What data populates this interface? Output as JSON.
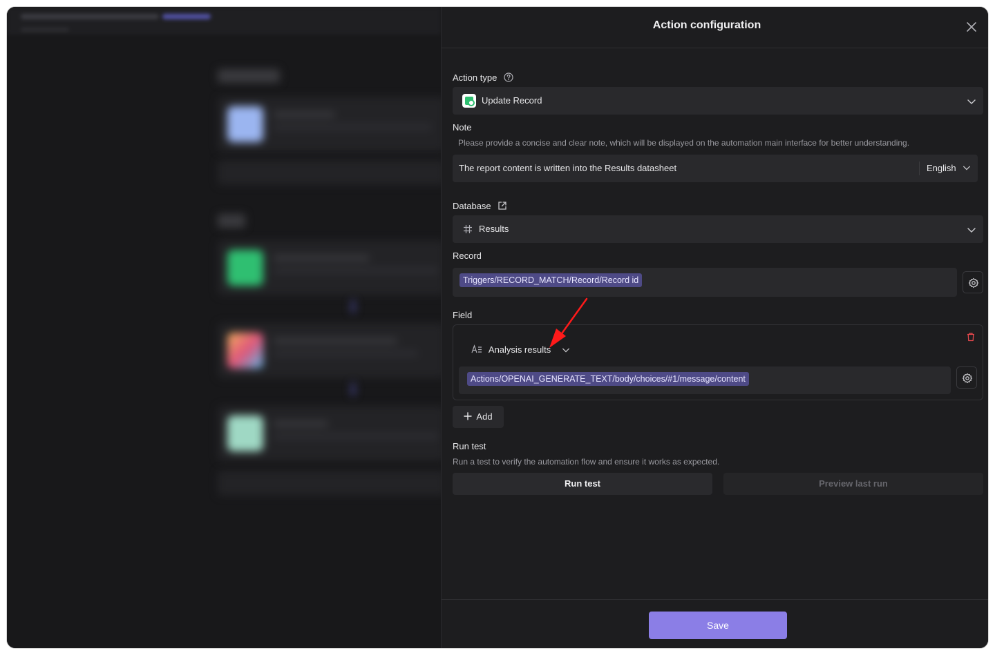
{
  "panel": {
    "title": "Action configuration"
  },
  "action_type": {
    "label": "Action type",
    "value": "Update Record"
  },
  "note": {
    "label": "Note",
    "description": "Please provide a concise and clear note, which will be displayed on the automation main interface for better understanding.",
    "value": "The report content is written into the Results datasheet",
    "language": "English"
  },
  "database": {
    "label": "Database",
    "value": "Results"
  },
  "record": {
    "label": "Record",
    "token": "Triggers/RECORD_MATCH/Record/Record id"
  },
  "field": {
    "label": "Field",
    "name": "Analysis results",
    "token": "Actions/OPENAI_GENERATE_TEXT/body/choices/#1/message/content",
    "add_label": "Add"
  },
  "run_test": {
    "label": "Run test",
    "description": "Run a test to verify the automation flow and ensure it works as expected.",
    "run_label": "Run test",
    "preview_label": "Preview last run"
  },
  "footer": {
    "save_label": "Save"
  },
  "colors": {
    "accent": "#8b7ee6",
    "chip": "#4e4a86",
    "danger": "#e5484d",
    "annotation_arrow": "#ff1a1a"
  }
}
